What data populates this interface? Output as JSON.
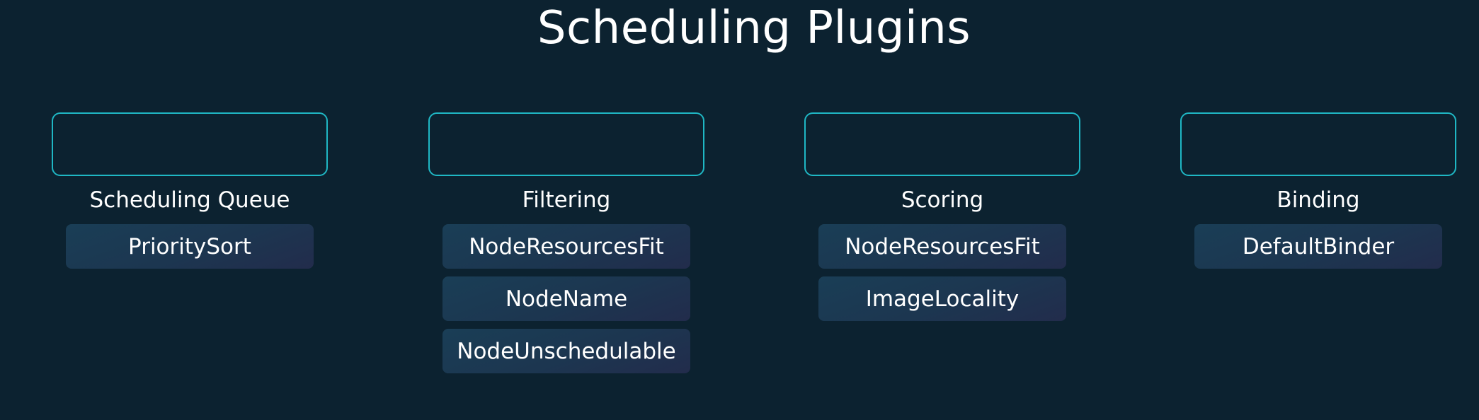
{
  "title": "Scheduling Plugins",
  "stages": [
    {
      "label": "Scheduling Queue",
      "plugins": [
        "PrioritySort"
      ]
    },
    {
      "label": "Filtering",
      "plugins": [
        "NodeResourcesFit",
        "NodeName",
        "NodeUnschedulable"
      ]
    },
    {
      "label": "Scoring",
      "plugins": [
        "NodeResourcesFit",
        "ImageLocality"
      ]
    },
    {
      "label": "Binding",
      "plugins": [
        "DefaultBinder"
      ]
    }
  ],
  "colors": {
    "background": "#0c2230",
    "stage_border": "#1fb7c4",
    "plugin_fill": "#1c3650",
    "text": "#ffffff"
  }
}
